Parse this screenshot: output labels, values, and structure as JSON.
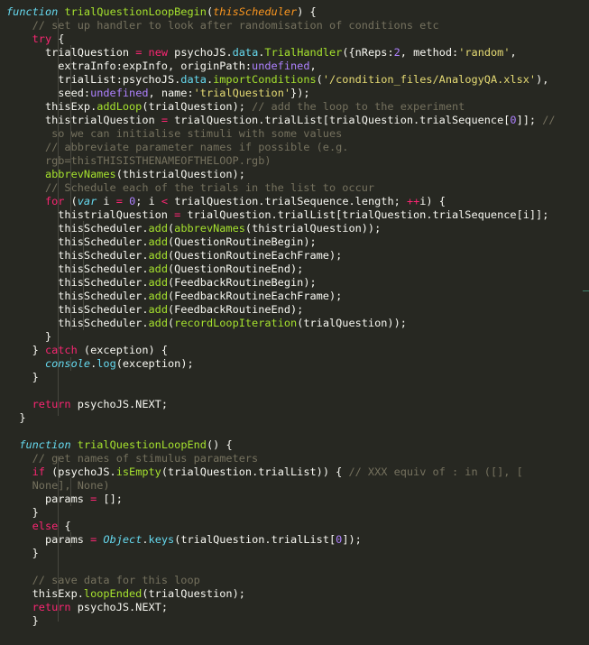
{
  "editor": {
    "language": "javascript",
    "theme": "monokai",
    "lines": [
      {
        "tokens": [
          [
            "storage",
            "function"
          ],
          [
            "plain",
            " "
          ],
          [
            "funcname",
            "trialQuestionLoopBegin"
          ],
          [
            "plain",
            "("
          ],
          [
            "param",
            "thisScheduler"
          ],
          [
            "plain",
            ") {"
          ]
        ]
      },
      {
        "tokens": [
          [
            "plain",
            "    "
          ],
          [
            "comment",
            "// set up handler to look after randomisation of conditions etc"
          ]
        ]
      },
      {
        "tokens": [
          [
            "plain",
            "    "
          ],
          [
            "keyword",
            "try"
          ],
          [
            "plain",
            " {"
          ]
        ]
      },
      {
        "tokens": [
          [
            "plain",
            "      trialQuestion "
          ],
          [
            "keyword",
            "="
          ],
          [
            "plain",
            " "
          ],
          [
            "keyword",
            "new"
          ],
          [
            "plain",
            " psychoJS."
          ],
          [
            "prop",
            "data"
          ],
          [
            "plain",
            "."
          ],
          [
            "classname",
            "TrialHandler"
          ],
          [
            "plain",
            "({nReps:"
          ],
          [
            "number",
            "2"
          ],
          [
            "plain",
            ", method:"
          ],
          [
            "string",
            "'random'"
          ],
          [
            "plain",
            ","
          ]
        ]
      },
      {
        "tokens": [
          [
            "plain",
            "        extraInfo:expInfo, originPath:"
          ],
          [
            "const",
            "undefined"
          ],
          [
            "plain",
            ","
          ]
        ]
      },
      {
        "tokens": [
          [
            "plain",
            "        trialList:psychoJS."
          ],
          [
            "prop",
            "data"
          ],
          [
            "plain",
            "."
          ],
          [
            "funcname",
            "importConditions"
          ],
          [
            "plain",
            "("
          ],
          [
            "string",
            "'/condition_files/AnalogyQA.xlsx'"
          ],
          [
            "plain",
            "),"
          ]
        ]
      },
      {
        "tokens": [
          [
            "plain",
            "        seed:"
          ],
          [
            "const",
            "undefined"
          ],
          [
            "plain",
            ", name:"
          ],
          [
            "string",
            "'trialQuestion'"
          ],
          [
            "plain",
            "});"
          ]
        ]
      },
      {
        "tokens": [
          [
            "plain",
            "      thisExp."
          ],
          [
            "funcname",
            "addLoop"
          ],
          [
            "plain",
            "(trialQuestion); "
          ],
          [
            "comment",
            "// add the loop to the experiment"
          ]
        ]
      },
      {
        "tokens": [
          [
            "plain",
            "      thistrialQuestion "
          ],
          [
            "keyword",
            "="
          ],
          [
            "plain",
            " trialQuestion.trialList[trialQuestion.trialSequence["
          ],
          [
            "number",
            "0"
          ],
          [
            "plain",
            "]]; "
          ],
          [
            "comment",
            "//"
          ]
        ]
      },
      {
        "tokens": [
          [
            "comment",
            "       so we can initialise stimuli with some values"
          ]
        ]
      },
      {
        "tokens": [
          [
            "plain",
            "      "
          ],
          [
            "comment",
            "// abbreviate parameter names if possible (e.g."
          ]
        ]
      },
      {
        "tokens": [
          [
            "comment",
            "      rgb=thisTHISISTHENAMEOFTHELOOP.rgb)"
          ]
        ]
      },
      {
        "tokens": [
          [
            "plain",
            "      "
          ],
          [
            "funcname",
            "abbrevNames"
          ],
          [
            "plain",
            "(thistrialQuestion);"
          ]
        ]
      },
      {
        "tokens": [
          [
            "plain",
            "      "
          ],
          [
            "comment",
            "// Schedule each of the trials in the list to occur"
          ]
        ]
      },
      {
        "tokens": [
          [
            "plain",
            "      "
          ],
          [
            "keyword",
            "for"
          ],
          [
            "plain",
            " ("
          ],
          [
            "storage",
            "var"
          ],
          [
            "plain",
            " i "
          ],
          [
            "keyword",
            "="
          ],
          [
            "plain",
            " "
          ],
          [
            "number",
            "0"
          ],
          [
            "plain",
            "; i "
          ],
          [
            "keyword",
            "<"
          ],
          [
            "plain",
            " trialQuestion.trialSequence.length; "
          ],
          [
            "keyword",
            "++"
          ],
          [
            "plain",
            "i) {"
          ]
        ]
      },
      {
        "tokens": [
          [
            "plain",
            "        thistrialQuestion "
          ],
          [
            "keyword",
            "="
          ],
          [
            "plain",
            " trialQuestion.trialList[trialQuestion.trialSequence[i]];"
          ]
        ]
      },
      {
        "tokens": [
          [
            "plain",
            "        thisScheduler."
          ],
          [
            "funcname",
            "add"
          ],
          [
            "plain",
            "("
          ],
          [
            "funcname",
            "abbrevNames"
          ],
          [
            "plain",
            "(thistrialQuestion));"
          ]
        ]
      },
      {
        "tokens": [
          [
            "plain",
            "        thisScheduler."
          ],
          [
            "funcname",
            "add"
          ],
          [
            "plain",
            "(QuestionRoutineBegin);"
          ]
        ]
      },
      {
        "tokens": [
          [
            "plain",
            "        thisScheduler."
          ],
          [
            "funcname",
            "add"
          ],
          [
            "plain",
            "(QuestionRoutineEachFrame);"
          ]
        ]
      },
      {
        "tokens": [
          [
            "plain",
            "        thisScheduler."
          ],
          [
            "funcname",
            "add"
          ],
          [
            "plain",
            "(QuestionRoutineEnd);"
          ]
        ]
      },
      {
        "tokens": [
          [
            "plain",
            "        thisScheduler."
          ],
          [
            "funcname",
            "add"
          ],
          [
            "plain",
            "(FeedbackRoutineBegin);"
          ]
        ]
      },
      {
        "tokens": [
          [
            "plain",
            "        thisScheduler."
          ],
          [
            "funcname",
            "add"
          ],
          [
            "plain",
            "(FeedbackRoutineEachFrame);"
          ]
        ]
      },
      {
        "tokens": [
          [
            "plain",
            "        thisScheduler."
          ],
          [
            "funcname",
            "add"
          ],
          [
            "plain",
            "(FeedbackRoutineEnd);"
          ]
        ]
      },
      {
        "tokens": [
          [
            "plain",
            "        thisScheduler."
          ],
          [
            "funcname",
            "add"
          ],
          [
            "plain",
            "("
          ],
          [
            "funcname",
            "recordLoopIteration"
          ],
          [
            "plain",
            "(trialQuestion));"
          ]
        ]
      },
      {
        "tokens": [
          [
            "plain",
            "      }"
          ]
        ]
      },
      {
        "tokens": [
          [
            "plain",
            "    } "
          ],
          [
            "keyword",
            "catch"
          ],
          [
            "plain",
            " (exception) {"
          ]
        ]
      },
      {
        "tokens": [
          [
            "plain",
            "      "
          ],
          [
            "builtin",
            "console"
          ],
          [
            "plain",
            "."
          ],
          [
            "prop",
            "log"
          ],
          [
            "plain",
            "(exception);"
          ]
        ]
      },
      {
        "tokens": [
          [
            "plain",
            "    }"
          ]
        ]
      },
      {
        "tokens": []
      },
      {
        "tokens": [
          [
            "plain",
            "    "
          ],
          [
            "keyword",
            "return"
          ],
          [
            "plain",
            " psychoJS.NEXT;"
          ]
        ]
      },
      {
        "tokens": [
          [
            "plain",
            "  }"
          ]
        ]
      },
      {
        "tokens": []
      },
      {
        "tokens": [
          [
            "plain",
            "  "
          ],
          [
            "storage",
            "function"
          ],
          [
            "plain",
            " "
          ],
          [
            "funcname",
            "trialQuestionLoopEnd"
          ],
          [
            "plain",
            "() {"
          ]
        ]
      },
      {
        "tokens": [
          [
            "plain",
            "    "
          ],
          [
            "comment",
            "// get names of stimulus parameters"
          ]
        ]
      },
      {
        "tokens": [
          [
            "plain",
            "    "
          ],
          [
            "keyword",
            "if"
          ],
          [
            "plain",
            " (psychoJS."
          ],
          [
            "funcname",
            "isEmpty"
          ],
          [
            "plain",
            "(trialQuestion.trialList)) { "
          ],
          [
            "comment",
            "// XXX equiv of : in ([], ["
          ]
        ]
      },
      {
        "tokens": [
          [
            "comment",
            "    None], None)"
          ]
        ]
      },
      {
        "tokens": [
          [
            "plain",
            "      params "
          ],
          [
            "keyword",
            "="
          ],
          [
            "plain",
            " [];"
          ]
        ]
      },
      {
        "tokens": [
          [
            "plain",
            "    }"
          ]
        ]
      },
      {
        "tokens": [
          [
            "plain",
            "    "
          ],
          [
            "keyword",
            "else"
          ],
          [
            "plain",
            " {"
          ]
        ]
      },
      {
        "tokens": [
          [
            "plain",
            "      params "
          ],
          [
            "keyword",
            "="
          ],
          [
            "plain",
            " "
          ],
          [
            "builtin",
            "Object"
          ],
          [
            "plain",
            "."
          ],
          [
            "prop",
            "keys"
          ],
          [
            "plain",
            "(trialQuestion.trialList["
          ],
          [
            "number",
            "0"
          ],
          [
            "plain",
            "]);"
          ]
        ]
      },
      {
        "tokens": [
          [
            "plain",
            "    }"
          ]
        ]
      },
      {
        "tokens": []
      },
      {
        "tokens": [
          [
            "plain",
            "    "
          ],
          [
            "comment",
            "// save data for this loop"
          ]
        ]
      },
      {
        "tokens": [
          [
            "plain",
            "    thisExp."
          ],
          [
            "funcname",
            "loopEnded"
          ],
          [
            "plain",
            "(trialQuestion);"
          ]
        ]
      },
      {
        "tokens": [
          [
            "plain",
            "    "
          ],
          [
            "keyword",
            "return"
          ],
          [
            "plain",
            " psychoJS.NEXT;"
          ]
        ]
      },
      {
        "tokens": [
          [
            "plain",
            "    }"
          ]
        ]
      }
    ]
  }
}
